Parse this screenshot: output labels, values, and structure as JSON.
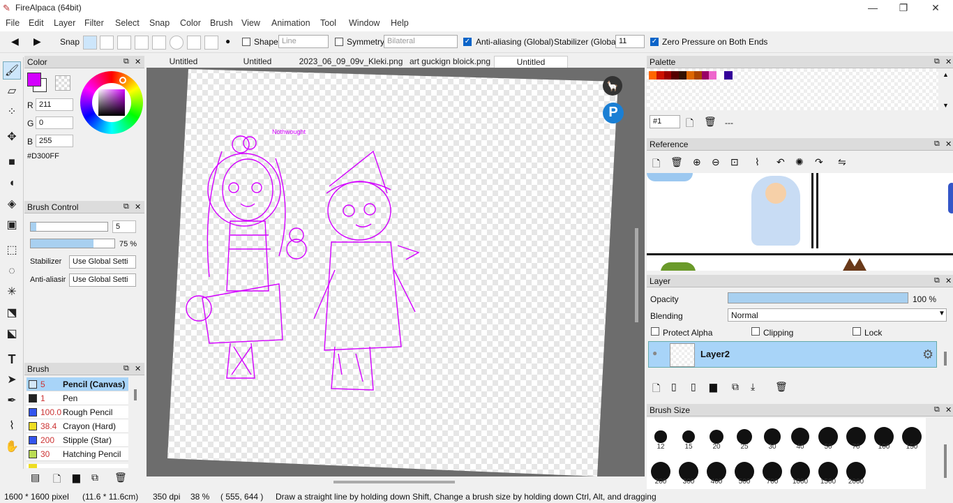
{
  "app": {
    "title": "FireAlpaca (64bit)"
  },
  "menu": [
    "File",
    "Edit",
    "Layer",
    "Filter",
    "Select",
    "Snap",
    "Color",
    "Brush",
    "View",
    "Animation",
    "Tool",
    "Window",
    "Help"
  ],
  "toolbar": {
    "snap_label": "Snap",
    "shape_label": "Shape",
    "shape_value": "Line",
    "symmetry_label": "Symmetry",
    "symmetry_value": "Bilateral",
    "antialias_label": "Anti-aliasing (Global)",
    "stabilizer_label": "Stabilizer (Global)",
    "stabilizer_value": "11",
    "zero_pressure_label": "Zero Pressure on Both Ends"
  },
  "tabs": [
    "Untitled",
    "Untitled",
    "2023_06_09_09v_Kleki.png",
    "art guckign bloick.png",
    "Untitled"
  ],
  "color": {
    "title": "Color",
    "r_label": "R",
    "r": "211",
    "g_label": "G",
    "g": "0",
    "b_label": "B",
    "b": "255",
    "hex": "#D300FF",
    "fg": "#D300FF"
  },
  "brush_control": {
    "title": "Brush Control",
    "size": "5",
    "opacity": "75 %",
    "stabilizer_label": "Stabilizer",
    "stabilizer_value": "Use Global Setti",
    "antialias_label": "Anti-aliasir",
    "antialias_value": "Use Global Setti"
  },
  "brush": {
    "title": "Brush",
    "items": [
      {
        "num": "5",
        "name": "Pencil (Canvas)",
        "color": "#d4e8f8"
      },
      {
        "num": "1",
        "name": "Pen",
        "color": "#222222"
      },
      {
        "num": "100.0",
        "name": "Rough Pencil",
        "color": "#3355ee"
      },
      {
        "num": "38.4",
        "name": "Crayon (Hard)",
        "color": "#eedd22"
      },
      {
        "num": "200",
        "name": "Stipple (Star)",
        "color": "#3355ee"
      },
      {
        "num": "30",
        "name": "Hatching Pencil",
        "color": "#bbdd55"
      }
    ]
  },
  "palette": {
    "title": "Palette",
    "page": "#1",
    "name": "---",
    "colors": [
      "#ff6600",
      "#cc1100",
      "#990000",
      "#550000",
      "#331100",
      "#dd6600",
      "#aa4400",
      "#990066",
      "#ee66cc",
      "#ffffff",
      "#330099"
    ]
  },
  "reference": {
    "title": "Reference"
  },
  "layer": {
    "title": "Layer",
    "opacity_label": "Opacity",
    "opacity": "100 %",
    "opacity_frac": 1.0,
    "blending_label": "Blending",
    "blending_value": "Normal",
    "protect_alpha": "Protect Alpha",
    "clipping": "Clipping",
    "lock": "Lock",
    "layer_name": "Layer2"
  },
  "brush_size": {
    "title": "Brush Size",
    "sizes": [
      "12",
      "15",
      "20",
      "25",
      "30",
      "40",
      "50",
      "70",
      "100",
      "150",
      "200",
      "300",
      "400",
      "500",
      "700",
      "1000",
      "1500",
      "2000"
    ]
  },
  "canvas_note": "Nothwought",
  "status": {
    "size": "1600 * 1600 pixel",
    "cm": "(11.6 * 11.6cm)",
    "dpi": "350 dpi",
    "zoom": "38 %",
    "coords": "( 555, 644 )",
    "hint": "Draw a straight line by holding down Shift, Change a brush size by holding down Ctrl, Alt, and dragging"
  }
}
